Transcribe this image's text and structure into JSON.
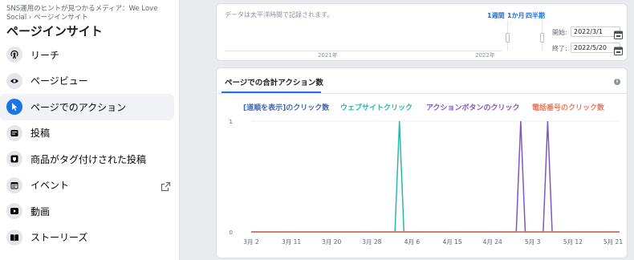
{
  "sidebar": {
    "breadcrumb": "SNS運用のヒントが見つかるメディア：We Love Social › ページインサイト",
    "title": "ページインサイト",
    "items": [
      {
        "label": "リーチ",
        "icon": "reach-icon"
      },
      {
        "label": "ページビュー",
        "icon": "eye-icon"
      },
      {
        "label": "ページでのアクション",
        "icon": "cursor-icon",
        "active": true
      },
      {
        "label": "投稿",
        "icon": "post-icon"
      },
      {
        "label": "商品がタグ付けされた投稿",
        "icon": "tag-icon"
      },
      {
        "label": "イベント",
        "icon": "calendar-icon",
        "external": true
      },
      {
        "label": "動画",
        "icon": "video-icon"
      },
      {
        "label": "ストーリーズ",
        "icon": "book-icon"
      }
    ]
  },
  "timeline": {
    "note": "データは太平洋時間で記録されます。",
    "ranges": [
      "1週間",
      "1か月",
      "四半期"
    ],
    "years": [
      "2021年",
      "2022年"
    ],
    "start_label": "開始:",
    "start_value": "2022/3/1",
    "end_label": "終了:",
    "end_value": "2022/5/20"
  },
  "chart_card": {
    "title": "ページでの合計アクション数",
    "info": "i"
  },
  "chart_data": {
    "type": "line",
    "legend": [
      {
        "name": "[道順を表示]のクリック数",
        "color": "#4267b2"
      },
      {
        "name": "ウェブサイトクリック",
        "color": "#2ab7a9"
      },
      {
        "name": "アクションボタンのクリック",
        "color": "#7e57c2"
      },
      {
        "name": "電話番号のクリック数",
        "color": "#f0785a"
      }
    ],
    "x_ticks": [
      "3月 2",
      "3月 11",
      "3月 20",
      "3月 28",
      "4月 6",
      "4月 15",
      "4月 24",
      "5月 3",
      "5月 12",
      "5月 21"
    ],
    "y_ticks": [
      "0",
      "1"
    ],
    "ylim": [
      0,
      1
    ],
    "series": [
      {
        "name": "[道順を表示]のクリック数",
        "color": "#4267b2",
        "points": []
      },
      {
        "name": "ウェブサイトクリック",
        "color": "#2ab7a9",
        "points": [
          {
            "date": "2022-04-03",
            "value": 1
          }
        ]
      },
      {
        "name": "アクションボタンのクリック",
        "color": "#7e57c2",
        "points": [
          {
            "date": "2022-04-30",
            "value": 1
          },
          {
            "date": "2022-05-06",
            "value": 1
          }
        ]
      },
      {
        "name": "電話番号のクリック数",
        "color": "#f0785a",
        "points": []
      }
    ]
  }
}
